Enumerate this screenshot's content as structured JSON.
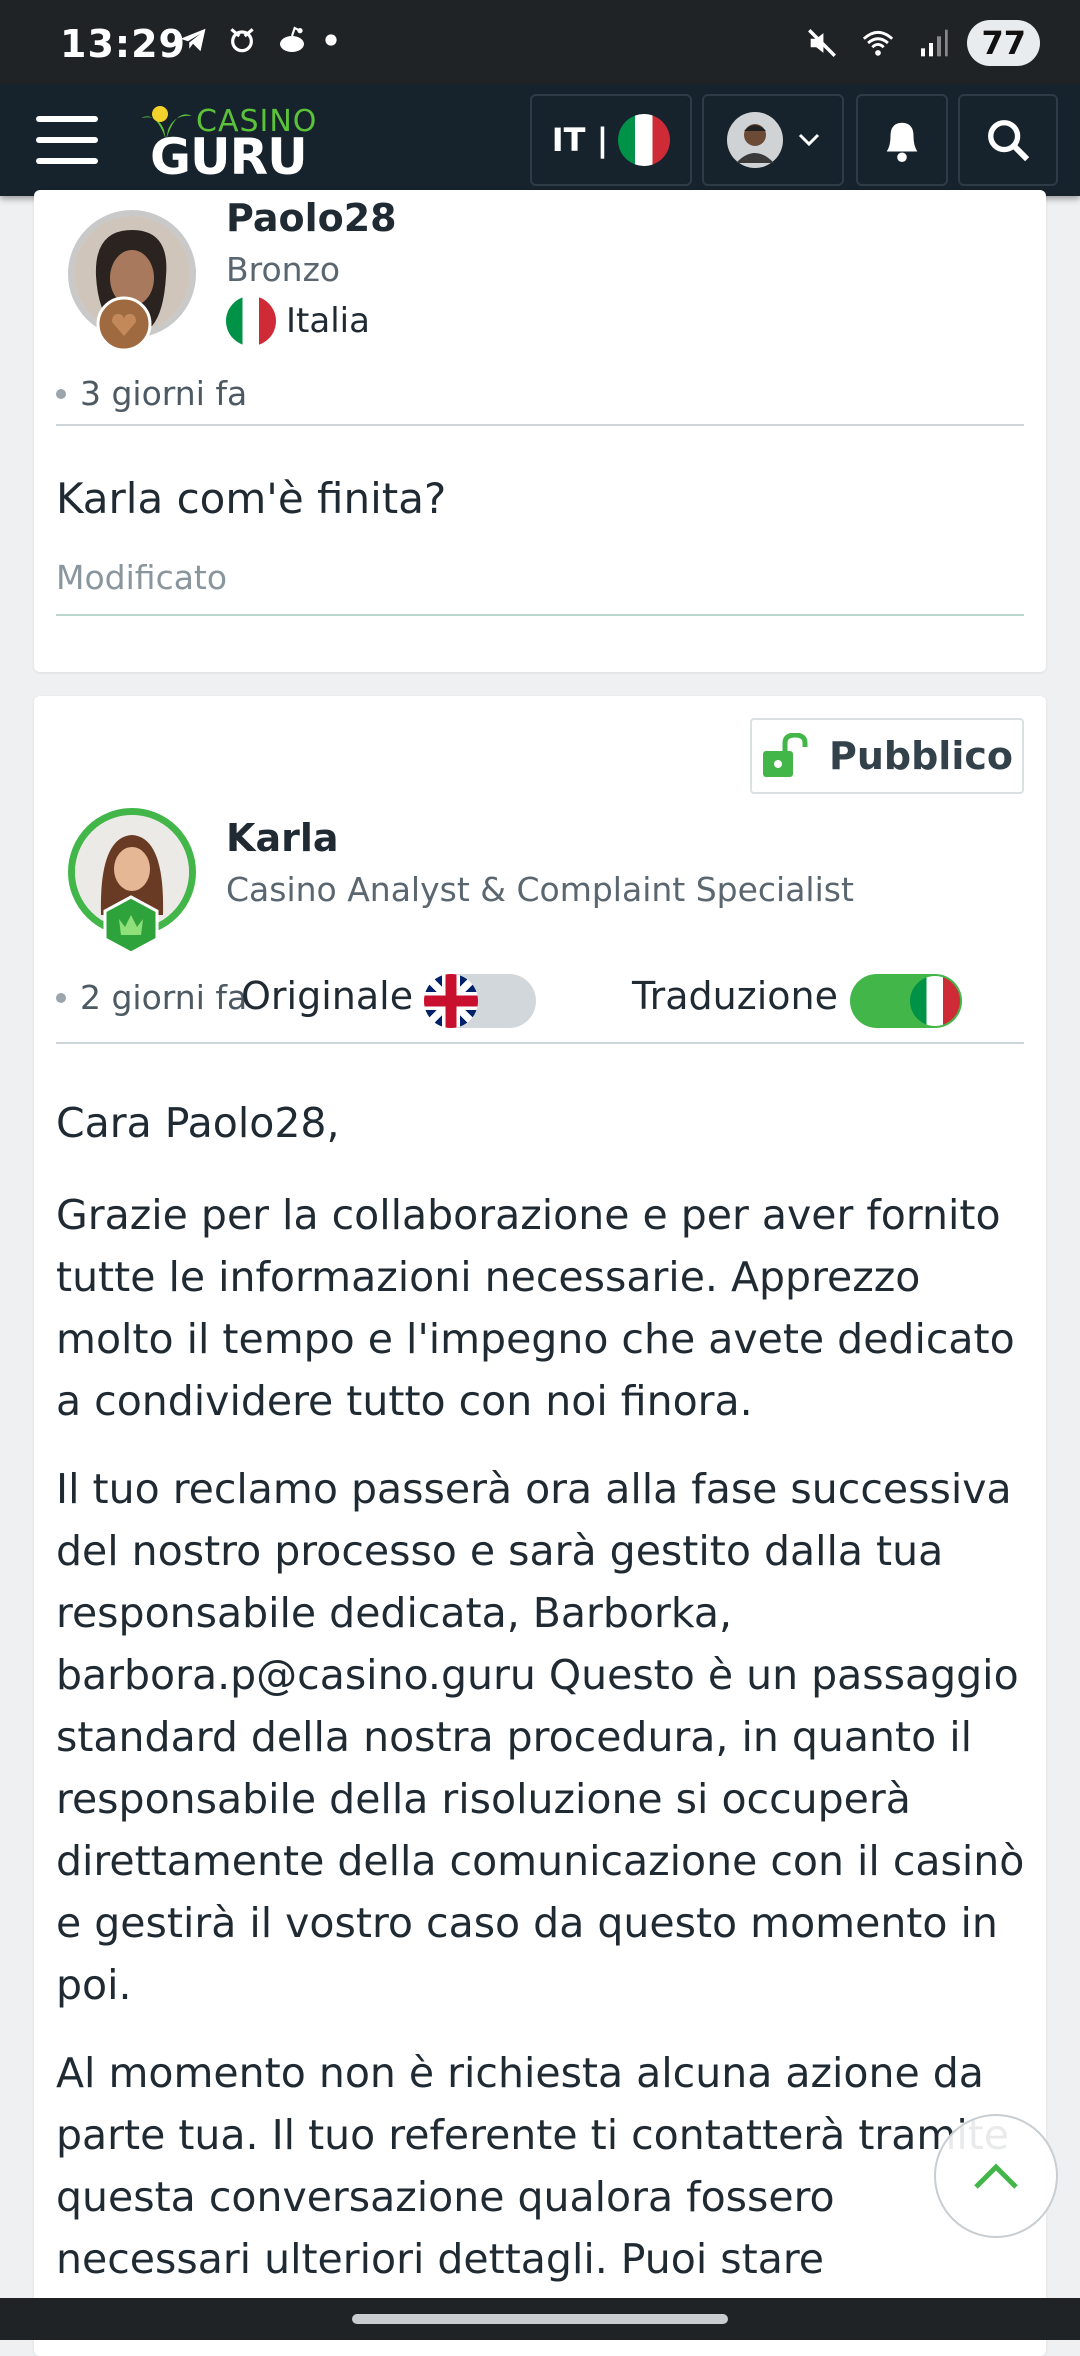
{
  "status_bar": {
    "time": "13:29",
    "battery": "77"
  },
  "header": {
    "logo_top": "CASINO",
    "logo_bottom": "GURU",
    "language": "IT |"
  },
  "post1": {
    "author": "Paolo28",
    "rank": "Bronzo",
    "country": "Italia",
    "time": "3 giorni fa",
    "text": "Karla com'è finita?",
    "edited": "Modificato"
  },
  "post2": {
    "visibility": "Pubblico",
    "author": "Karla",
    "role": "Casino Analyst & Complaint Specialist",
    "time": "2 giorni fa",
    "original_label": "Originale",
    "translation_label": "Traduzione",
    "original_toggle_on": false,
    "translation_toggle_on": true,
    "paragraphs": [
      "Cara Paolo28,",
      "Grazie per la collaborazione e per aver fornito tutte le informazioni necessarie. Apprezzo molto il tempo e l'impegno che avete dedicato a condividere tutto con noi finora.",
      "Il tuo reclamo passerà ora alla fase successiva del nostro processo e sarà gestito dalla tua responsabile dedicata, Barborka, barbora.p@casino.guru Questo è un passaggio standard della nostra procedura, in quanto il responsabile della risoluzione si occuperà direttamente della comunicazione con il casinò e gestirà il vostro caso da questo momento in poi.",
      "Al momento non è richiesta alcuna azione da parte tua. Il tuo referente ti contatterà tramite questa conversazione qualora fossero necessari ulteriori dettagli. Puoi stare"
    ]
  },
  "colors": {
    "brand_green": "#5cc23a",
    "nav_bg": "#16232d",
    "toggle_on": "#43b649",
    "toggle_off": "#d2d7db"
  }
}
